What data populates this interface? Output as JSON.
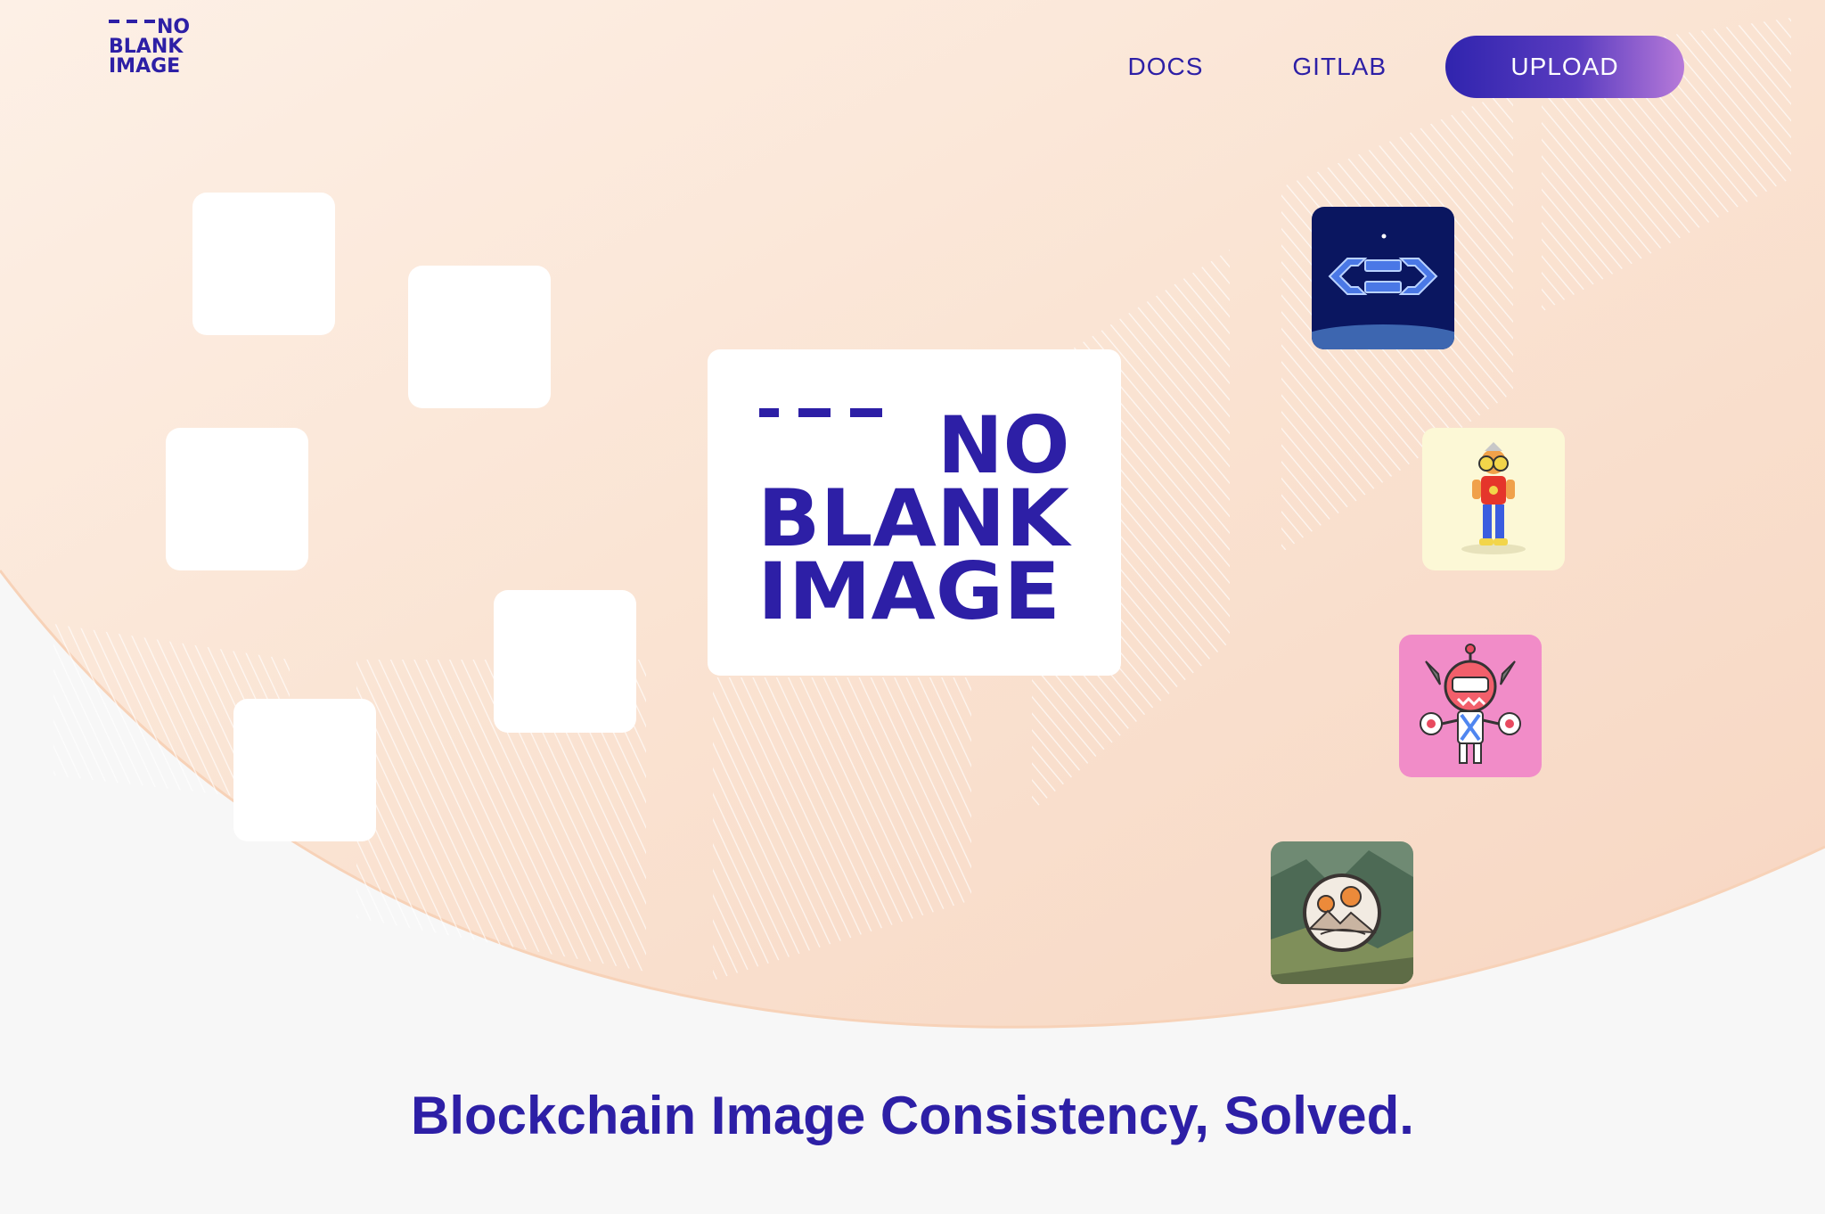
{
  "brand": {
    "logo_line1": "NO",
    "logo_line2": "BLANK",
    "logo_line3": "IMAGE",
    "color_primary": "#2d1fa6",
    "color_bg_peach": "#f9ddc9"
  },
  "nav": {
    "docs": "DOCS",
    "gitlab": "GITLAB",
    "upload": "UPLOAD"
  },
  "hero": {
    "tagline": "Blockchain Image Consistency, Solved."
  },
  "nft_tiles": [
    {
      "name": "csd-logo",
      "icon": "chain-logo-icon"
    },
    {
      "name": "cartoon-character",
      "icon": "character-icon"
    },
    {
      "name": "robot-character",
      "icon": "robot-icon"
    },
    {
      "name": "landscape-badge",
      "icon": "mountain-badge-icon"
    }
  ]
}
